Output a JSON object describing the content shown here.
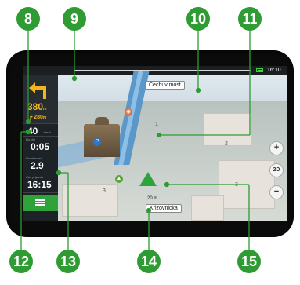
{
  "status_bar": {
    "time": "16:10",
    "colors": {
      "bar": "#1b1f22",
      "battery": "#3bd23b"
    }
  },
  "maneuver": {
    "distance": "380",
    "distance_unit": "m",
    "next_turn_distance": "280",
    "next_turn_unit": "m",
    "icon": "turn-left-arrow-icon"
  },
  "speed": {
    "value": "40",
    "unit": "km/h"
  },
  "time_to_destination": {
    "label": "Do cile",
    "value": "0:05"
  },
  "distance_remaining": {
    "label": "Vzdalenost",
    "value": "2.9"
  },
  "arrival_time": {
    "label": "Cas prijezdu",
    "value": "16:15"
  },
  "menu": {
    "icon": "menu-icon"
  },
  "map": {
    "next_street": "Cechuv most",
    "current_street": "Krizovnicka",
    "distance_to_turn": "20 m",
    "building_numbers": [
      "2",
      "1",
      "3",
      "3"
    ]
  },
  "controls": {
    "zoom_in": "+",
    "view_mode": "2D",
    "zoom_out": "−"
  },
  "callouts": [
    "8",
    "9",
    "10",
    "11",
    "12",
    "13",
    "14",
    "15"
  ],
  "colors": {
    "accent_green": "#2e9b33",
    "maneuver_yellow": "#f2b51d",
    "route_blue": "#5b97c8"
  }
}
